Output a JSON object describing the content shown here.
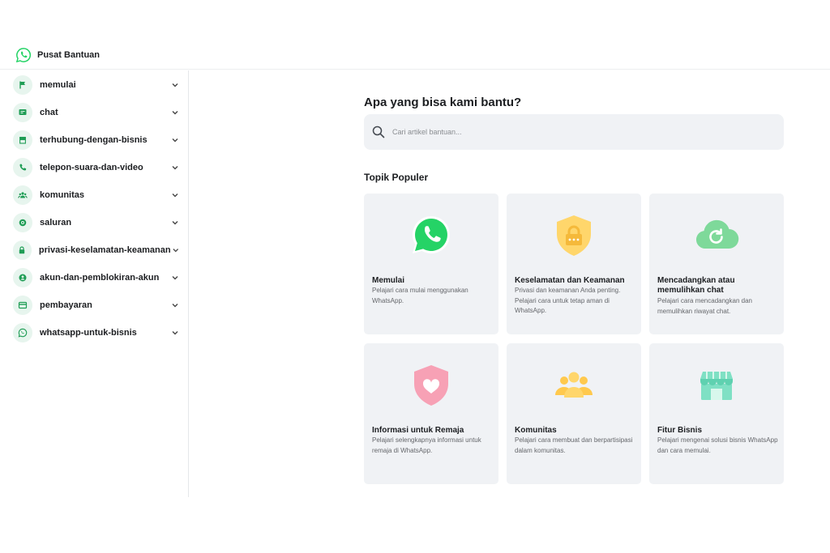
{
  "header": {
    "brand_title": "Pusat Bantuan"
  },
  "sidebar": {
    "items": [
      {
        "label": "memulai",
        "icon": "flag-icon"
      },
      {
        "label": "chat",
        "icon": "chat-icon"
      },
      {
        "label": "terhubung-dengan-bisnis",
        "icon": "store-icon"
      },
      {
        "label": "telepon-suara-dan-video",
        "icon": "phone-icon"
      },
      {
        "label": "komunitas",
        "icon": "people-icon"
      },
      {
        "label": "saluran",
        "icon": "channel-icon"
      },
      {
        "label": "privasi-keselamatan-keamanan",
        "icon": "lock-icon"
      },
      {
        "label": "akun-dan-pemblokiran-akun",
        "icon": "account-icon"
      },
      {
        "label": "pembayaran",
        "icon": "card-icon"
      },
      {
        "label": "whatsapp-untuk-bisnis",
        "icon": "whatsapp-icon"
      }
    ]
  },
  "main": {
    "title": "Apa yang bisa kami bantu?",
    "search": {
      "placeholder": "Cari artikel bantuan..."
    },
    "popular_title": "Topik Populer",
    "cards": [
      {
        "title": "Memulai",
        "description": "Pelajari cara mulai menggunakan WhatsApp.",
        "icon": "whatsapp-logo-icon"
      },
      {
        "title": "Keselamatan dan Keamanan",
        "description": "Privasi dan keamanan Anda penting. Pelajari cara untuk tetap aman di WhatsApp.",
        "icon": "shield-lock-icon"
      },
      {
        "title": "Mencadangkan atau memulihkan chat",
        "description": "Pelajari cara mencadangkan dan memulihkan riwayat chat.",
        "icon": "cloud-backup-icon"
      },
      {
        "title": "Informasi untuk Remaja",
        "description": "Pelajari selengkapnya informasi untuk remaja di WhatsApp.",
        "icon": "shield-heart-icon"
      },
      {
        "title": "Komunitas",
        "description": "Pelajari cara membuat dan berpartisipasi dalam komunitas.",
        "icon": "community-icon"
      },
      {
        "title": "Fitur Bisnis",
        "description": "Pelajari mengenai solusi bisnis WhatsApp dan cara memulai.",
        "icon": "storefront-icon"
      }
    ]
  },
  "colors": {
    "brand_green": "#25d366",
    "icon_green": "#1f9d55",
    "card_bg": "#f0f2f5",
    "shield_yellow": "#ffd66b",
    "shield_pink": "#f7a1b5",
    "cloud_green": "#7ed99a",
    "community_yellow": "#ffc94d",
    "store_teal": "#7fe0c4"
  }
}
